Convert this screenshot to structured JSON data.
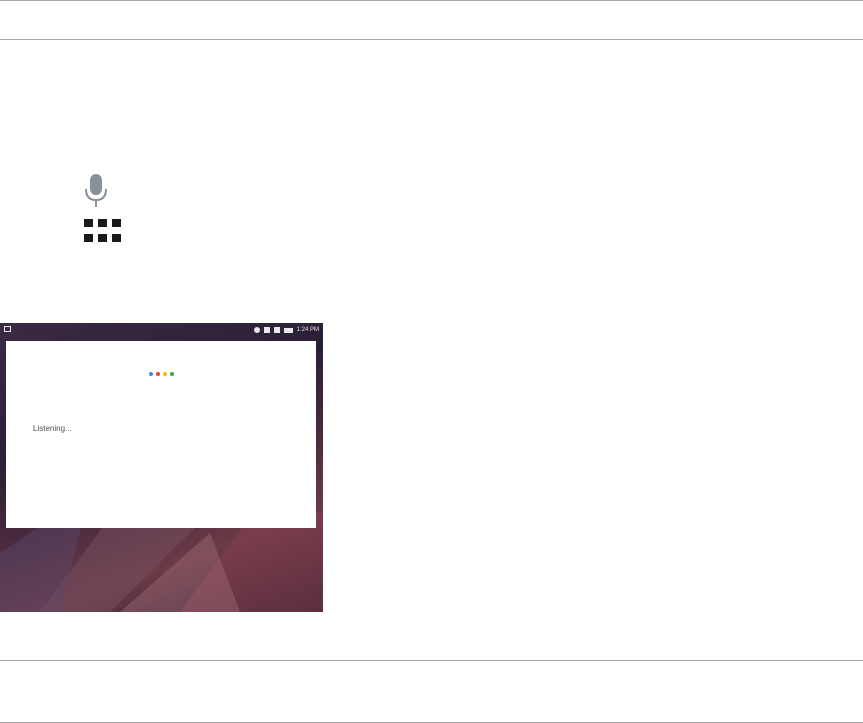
{
  "icons": {
    "microphone": "microphone-icon",
    "apps": "apps-grid-icon"
  },
  "screenshot": {
    "status_time": "1:24 PM",
    "assistant_text": "Listening...",
    "assistant_dot_colors": [
      "#4285f4",
      "#ea4335",
      "#fbbc05",
      "#34a853"
    ]
  }
}
